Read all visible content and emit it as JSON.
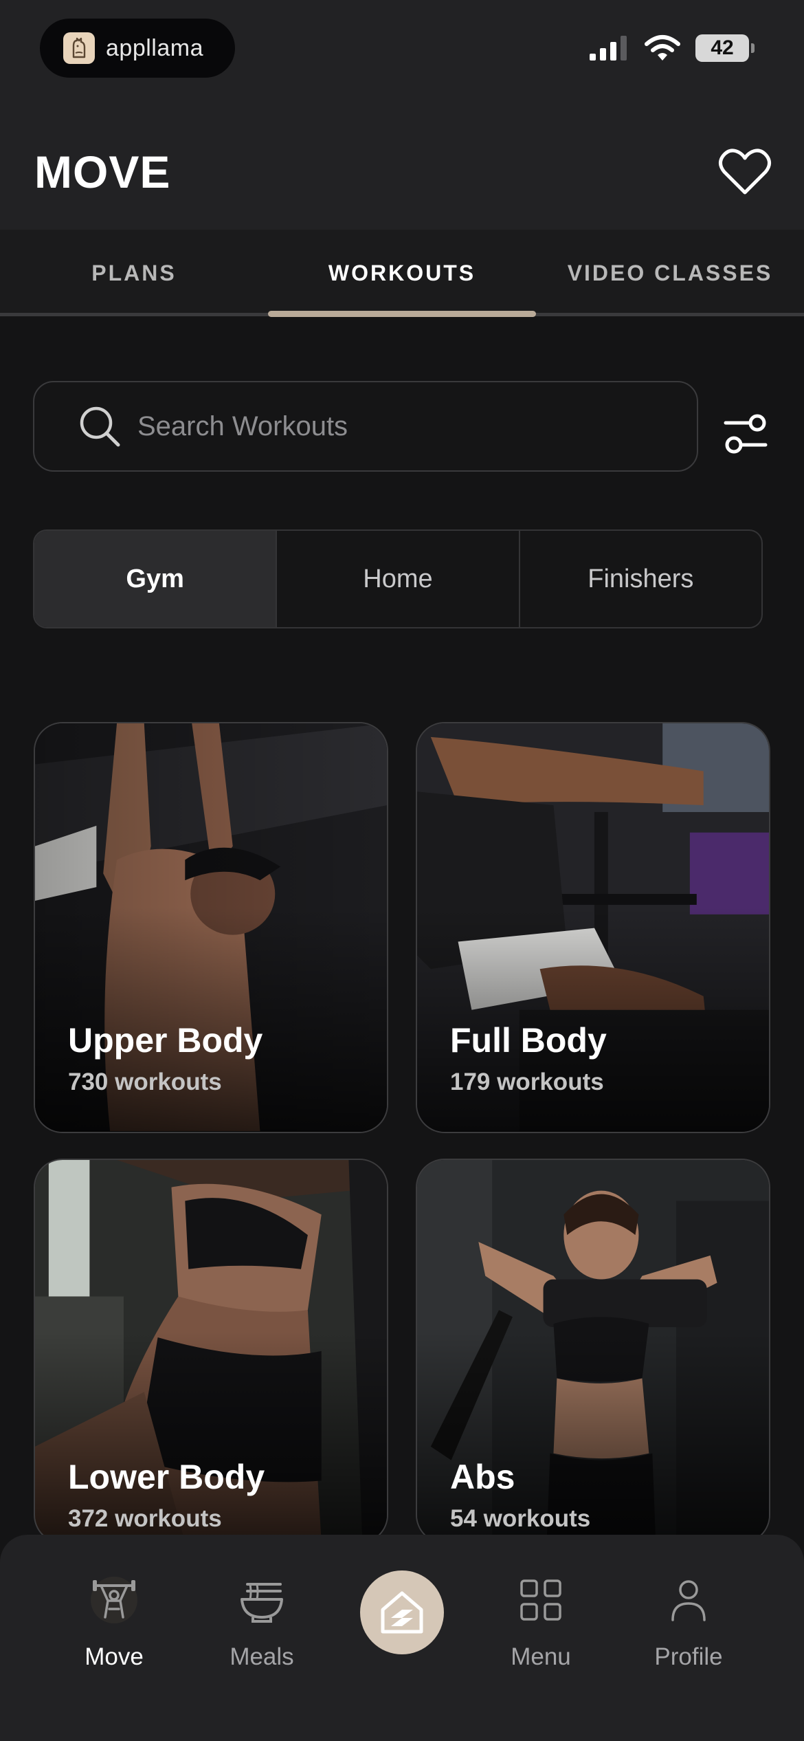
{
  "status_bar": {
    "app_pill_name": "appllama",
    "battery": "42"
  },
  "header": {
    "title": "MOVE"
  },
  "tabs": [
    {
      "label": "PLANS"
    },
    {
      "label": "WORKOUTS"
    },
    {
      "label": "VIDEO CLASSES"
    }
  ],
  "active_tab": "WORKOUTS",
  "search": {
    "placeholder": "Search Workouts",
    "value": ""
  },
  "segments": [
    {
      "label": "Gym"
    },
    {
      "label": "Home"
    },
    {
      "label": "Finishers"
    }
  ],
  "active_segment": "Gym",
  "cards": [
    {
      "title": "Upper Body",
      "subtitle": "730 workouts"
    },
    {
      "title": "Full Body",
      "subtitle": "179 workouts"
    },
    {
      "title": "Lower Body",
      "subtitle": "372 workouts"
    },
    {
      "title": "Abs",
      "subtitle": "54 workouts"
    }
  ],
  "bottom_nav": [
    {
      "label": "Move",
      "icon": "weightlifter-icon"
    },
    {
      "label": "Meals",
      "icon": "bowl-icon"
    },
    {
      "label": "Menu",
      "icon": "grid-icon"
    },
    {
      "label": "Profile",
      "icon": "person-icon"
    }
  ],
  "colors": {
    "background": "#141415",
    "header": "#222224",
    "accent": "#d5c7b7",
    "tab_indicator": "#b9aa98"
  }
}
